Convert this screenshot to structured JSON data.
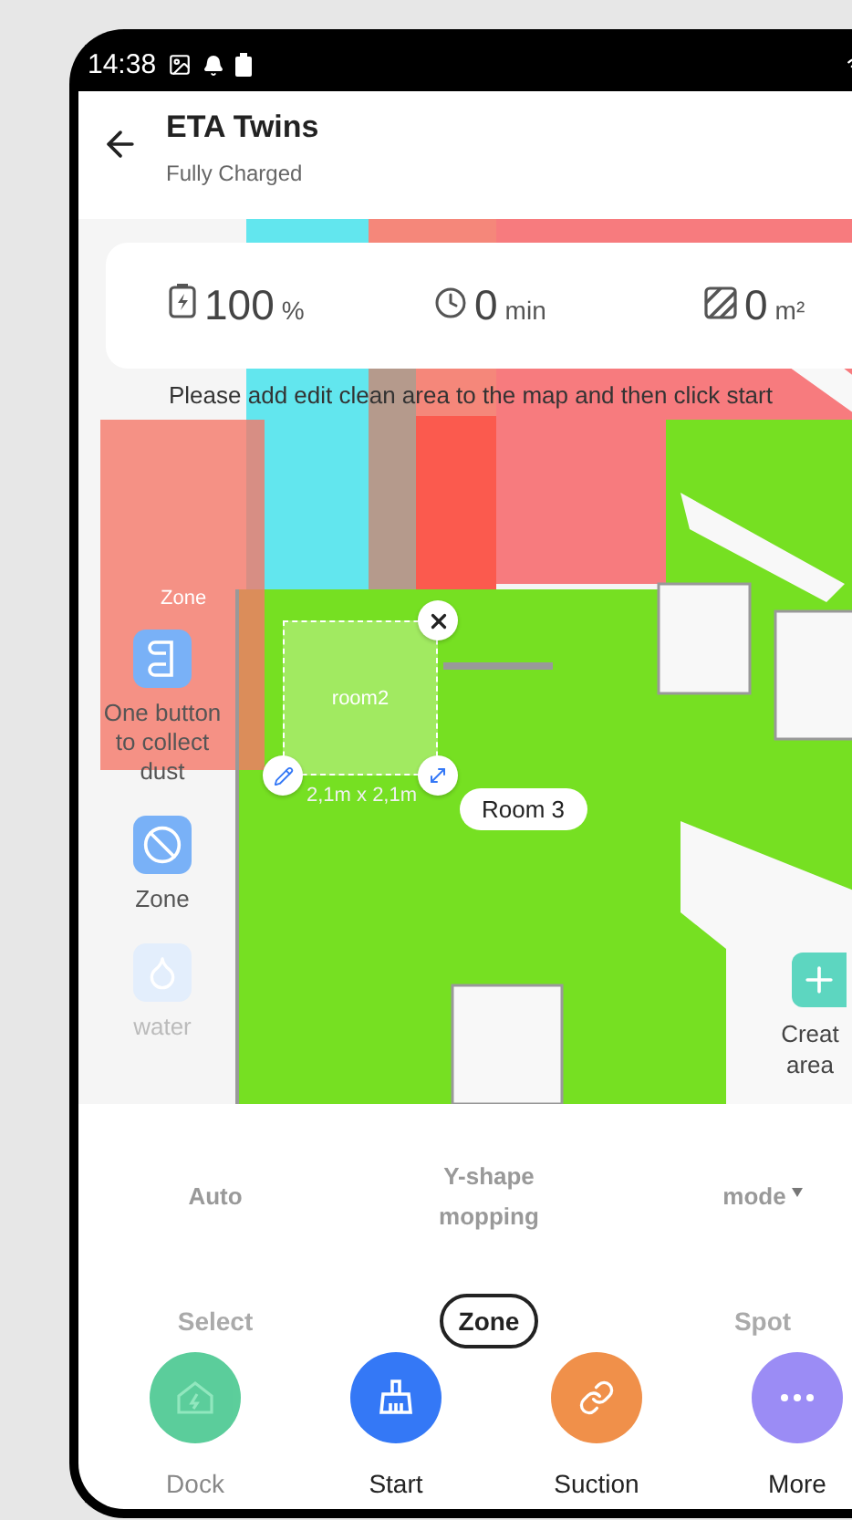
{
  "status_bar": {
    "time": "14:38"
  },
  "header": {
    "title": "ETA Twins",
    "subtitle": "Fully Charged"
  },
  "stats": [
    {
      "kind": "battery",
      "value": "100",
      "unit": "%"
    },
    {
      "kind": "time",
      "value": "0",
      "unit": "min"
    },
    {
      "kind": "area",
      "value": "0",
      "unit": "m²"
    }
  ],
  "hint": "Please add edit clean area to the map and then click start",
  "map": {
    "zone_label": "Zone",
    "selected_zone": {
      "label": "room2",
      "size": "2,1m x 2,1m"
    },
    "room_label": "Room 3",
    "create_button": "Creat area"
  },
  "side_tools": [
    {
      "kind": "dust",
      "label": "One button to collect dust",
      "disabled": false
    },
    {
      "kind": "zone",
      "label": "Zone",
      "disabled": false
    },
    {
      "kind": "water",
      "label": "water",
      "disabled": true
    }
  ],
  "mode_options": [
    {
      "label": "Auto",
      "dropdown": false
    },
    {
      "label": "Y-shape mopping",
      "dropdown": false
    },
    {
      "label": "mode",
      "dropdown": true
    }
  ],
  "clean_types": [
    {
      "label": "Select",
      "selected": false
    },
    {
      "label": "Zone",
      "selected": true
    },
    {
      "label": "Spot",
      "selected": false
    }
  ],
  "actions": [
    {
      "kind": "dock",
      "label": "Dock",
      "disabled": true
    },
    {
      "kind": "start",
      "label": "Start",
      "disabled": false
    },
    {
      "kind": "suction",
      "label": "Suction",
      "disabled": false
    },
    {
      "kind": "more",
      "label": "More",
      "disabled": false
    }
  ]
}
